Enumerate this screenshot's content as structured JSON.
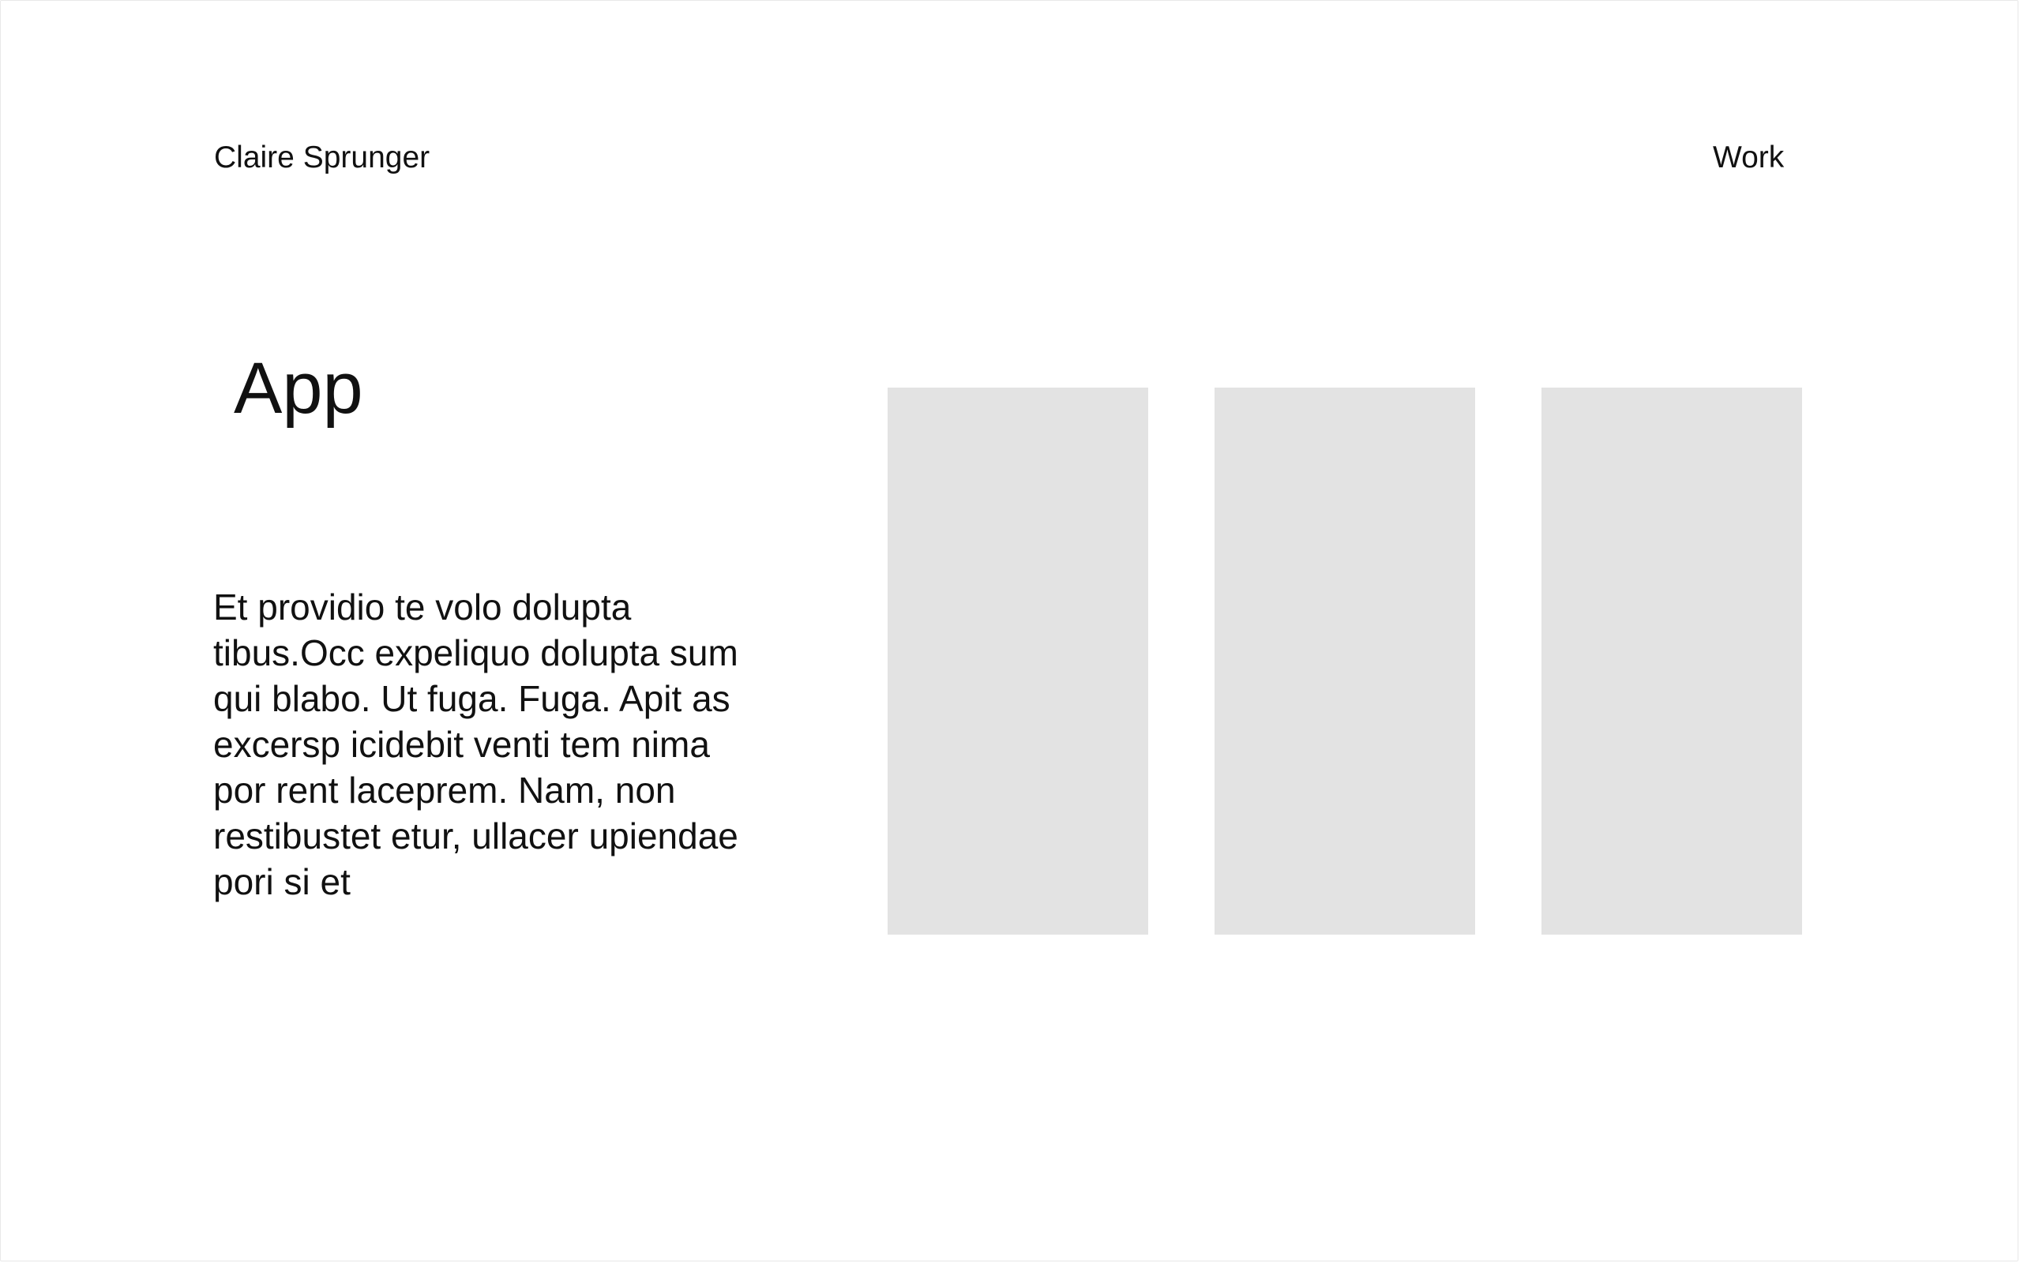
{
  "header": {
    "site_name": "Claire Sprunger",
    "nav": {
      "work_label": "Work"
    }
  },
  "main": {
    "title": "App",
    "description": "Et providio te volo dolupta tibus.Occ expeliquo dolupta sum qui blabo. Ut fuga. Fuga. Apit as excersp icidebit venti tem nima por rent laceprem. Nam, non restibustet etur, ullacer upiendae pori si et"
  },
  "gallery": {
    "placeholder_color": "#e3e3e3"
  }
}
